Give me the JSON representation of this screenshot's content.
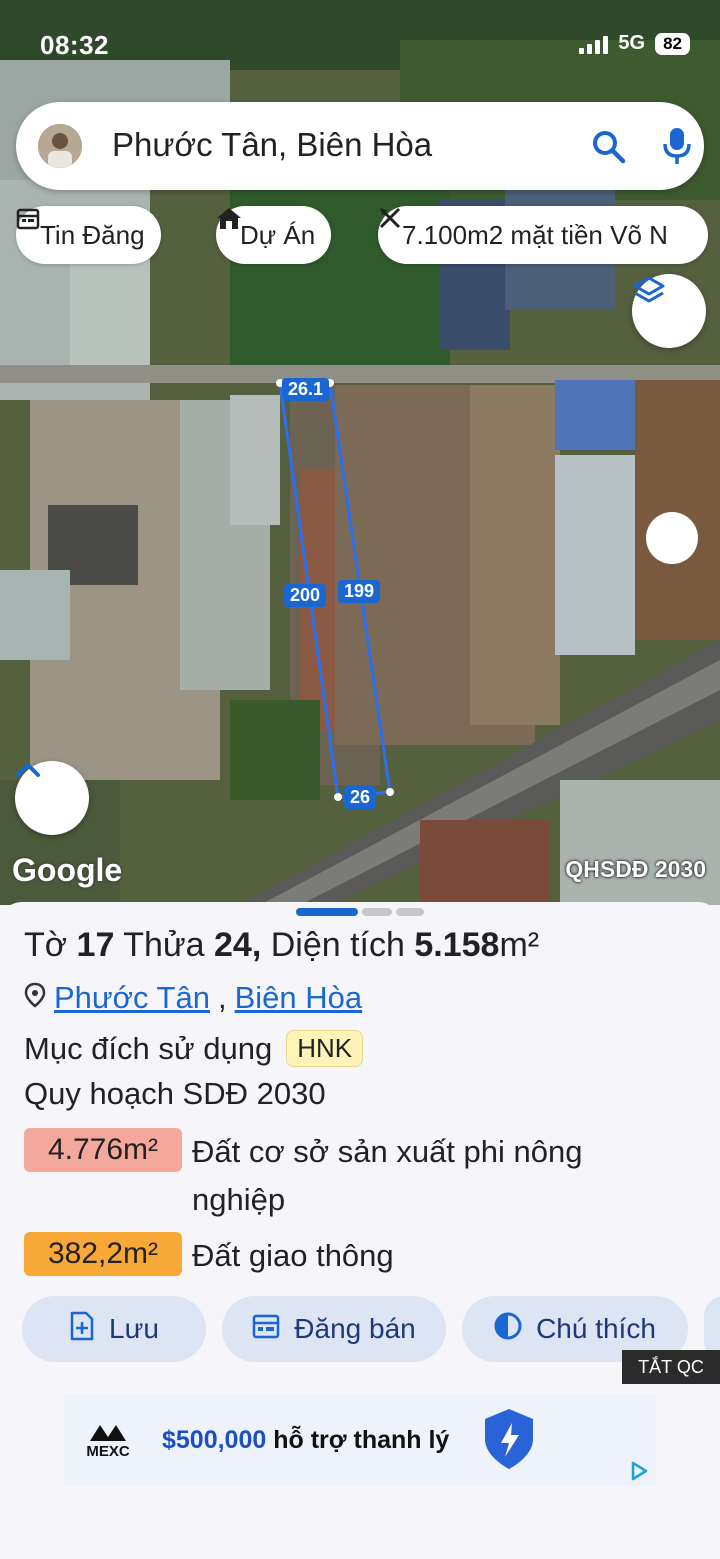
{
  "status_bar": {
    "time": "08:32",
    "network": "5G",
    "battery": "82"
  },
  "search": {
    "query": "Phước Tân, Biên Hòa"
  },
  "chips": [
    {
      "label": "Tin Đăng",
      "icon": "calendar-icon"
    },
    {
      "label": "Dự Án",
      "icon": "home-icon"
    },
    {
      "label": "7.100m2 mặt tiền Võ N",
      "icon": "ruler-icon"
    }
  ],
  "map": {
    "attribution": "Google",
    "layer_label": "QHSDĐ 2030",
    "edge_labels": [
      "26.1",
      "200",
      "199",
      "26"
    ]
  },
  "parcel": {
    "to_label": "Tờ",
    "to_value": "17",
    "thua_label": "Thửa",
    "thua_value": "24,",
    "area_label": "Diện tích",
    "area_value": "5.158",
    "area_unit": "m²",
    "ward": "Phước Tân",
    "city": "Biên Hòa",
    "purpose_label": "Mục đích sử dụng",
    "purpose_code": "HNK",
    "plan_title": "Quy hoạch SDĐ 2030",
    "zones": [
      {
        "area": "4.776m²",
        "description": "Đất cơ sở sản xuất phi nông nghiệp",
        "color": "#f4a79b"
      },
      {
        "area": "382,2m²",
        "description": "Đất giao thông",
        "color": "#f8a837"
      }
    ]
  },
  "actions": [
    {
      "label": "Lưu",
      "icon": "save-icon"
    },
    {
      "label": "Đăng bán",
      "icon": "listing-icon"
    },
    {
      "label": "Chú thích",
      "icon": "legend-icon"
    }
  ],
  "ad": {
    "close_label": "TẮT QC",
    "brand": "MEXC",
    "amount": "$500,000",
    "text": "hỗ trợ thanh lý"
  },
  "colors": {
    "accent": "#1a67d2",
    "chip_bg": "#ffffff",
    "action_bg": "#dde4f4"
  }
}
